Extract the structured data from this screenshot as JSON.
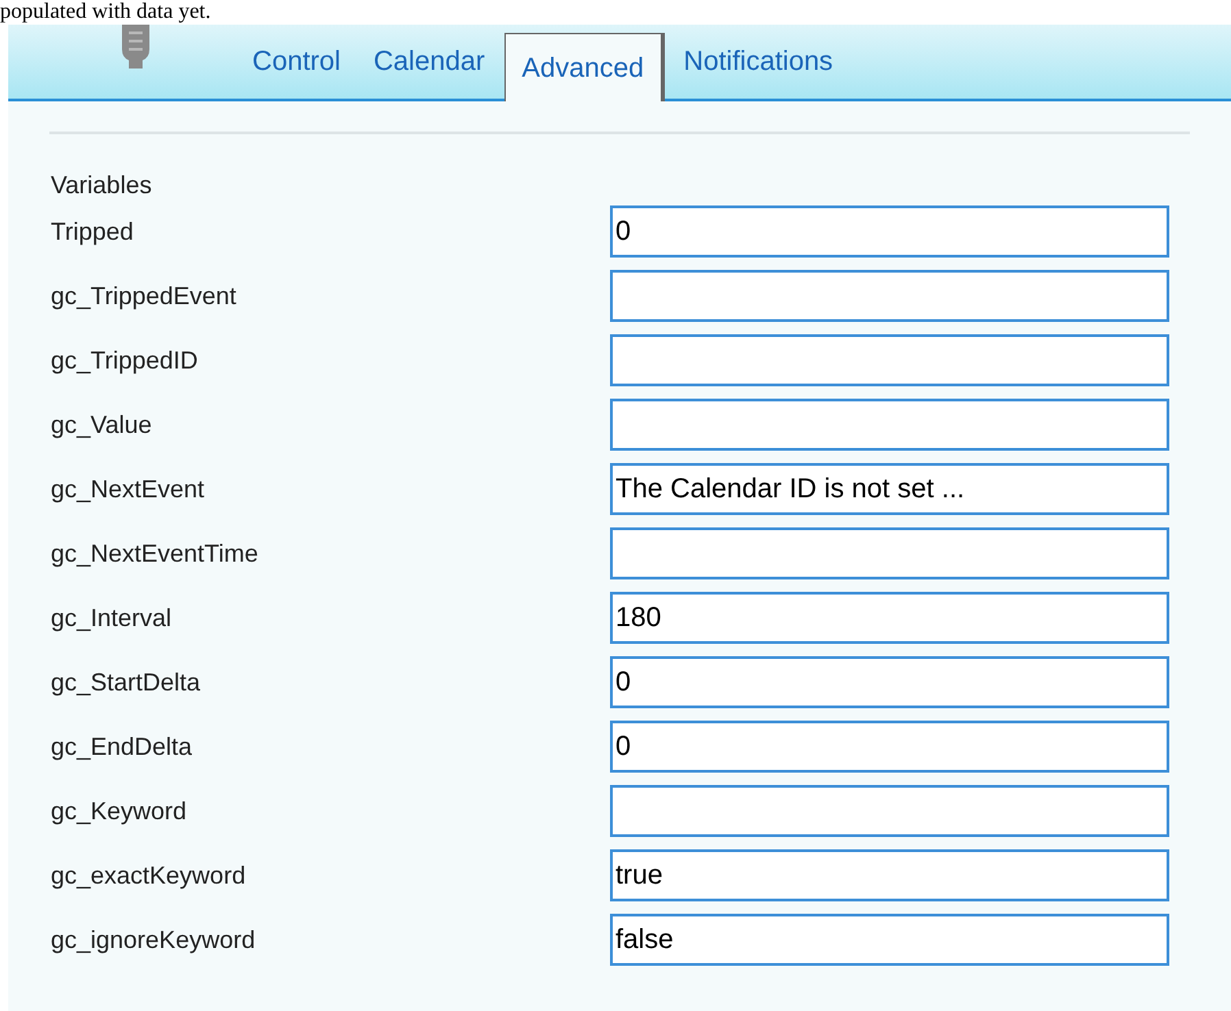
{
  "intro_text": "populated with data yet.",
  "tabs": [
    {
      "label": "Control",
      "selected": false
    },
    {
      "label": "Calendar",
      "selected": false
    },
    {
      "label": "Advanced",
      "selected": true
    },
    {
      "label": "Notifications",
      "selected": false
    }
  ],
  "section_title": "Variables",
  "variables": [
    {
      "name": "Tripped",
      "value": "0"
    },
    {
      "name": "gc_TrippedEvent"
    },
    {
      "name": "gc_TrippedID"
    },
    {
      "name": "gc_Value"
    },
    {
      "name": "gc_NextEvent",
      "value": "The Calendar ID is not set ..."
    },
    {
      "name": "gc_NextEventTime"
    },
    {
      "name": "gc_Interval",
      "value": "180"
    },
    {
      "name": "gc_StartDelta",
      "value": "0"
    },
    {
      "name": "gc_EndDelta",
      "value": "0"
    },
    {
      "name": "gc_Keyword"
    },
    {
      "name": "gc_exactKeyword",
      "value": "true"
    },
    {
      "name": "gc_ignoreKeyword",
      "value": "false"
    }
  ]
}
